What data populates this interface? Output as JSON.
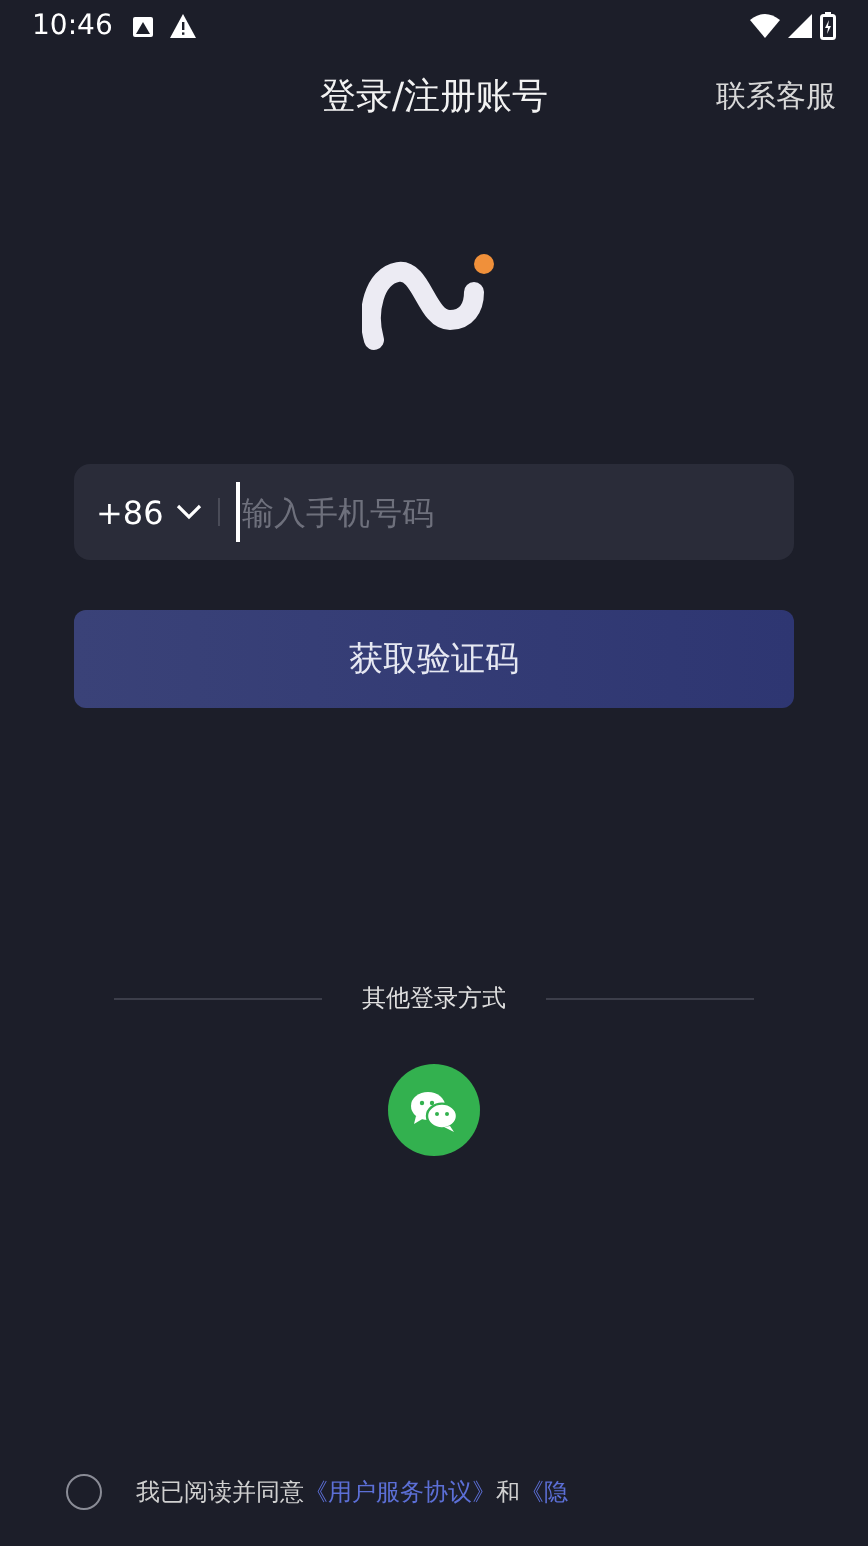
{
  "status_bar": {
    "time": "10:46"
  },
  "header": {
    "title": "登录/注册账号",
    "action": "联系客服"
  },
  "phone_field": {
    "country_code": "+86",
    "placeholder": "输入手机号码"
  },
  "submit_button": {
    "label": "获取验证码"
  },
  "other_login": {
    "label": "其他登录方式"
  },
  "agreement": {
    "checked": false,
    "parts": [
      {
        "kind": "text",
        "text": "我已阅读并同意"
      },
      {
        "kind": "link",
        "text": "《用户服务协议》"
      },
      {
        "kind": "text",
        "text": "和"
      },
      {
        "kind": "link",
        "text": "《隐"
      }
    ]
  }
}
